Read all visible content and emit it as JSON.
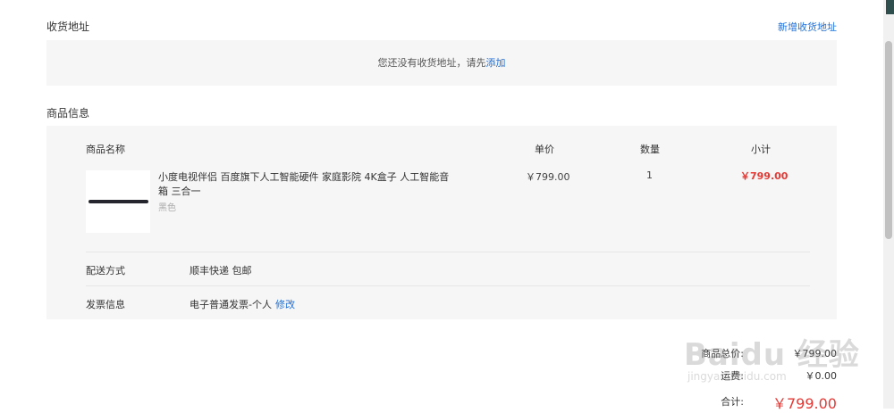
{
  "address": {
    "section_title": "收货地址",
    "add_new_label": "新增收货地址",
    "empty_prefix": "您还没有收货地址，请先",
    "empty_link": "添加"
  },
  "goods": {
    "section_title": "商品信息",
    "columns": {
      "name": "商品名称",
      "price": "单价",
      "quantity": "数量",
      "subtotal": "小计"
    },
    "item": {
      "title": "小度电视伴侣 百度旗下人工智能硬件 家庭影院 4K盒子 人工智能音箱 三合一",
      "variant": "黑色",
      "price": "￥799.00",
      "quantity": "1",
      "subtotal": "￥799.00"
    },
    "delivery": {
      "label": "配送方式",
      "value": "顺丰快递 包邮"
    },
    "invoice": {
      "label": "发票信息",
      "value": "电子普通发票-个人",
      "edit_label": "修改"
    }
  },
  "summary": {
    "goods_total_label": "商品总价:",
    "goods_total_value": "￥799.00",
    "shipping_label": "运费:",
    "shipping_value": "￥0.00",
    "total_label": "合计:",
    "total_value": "￥799.00"
  },
  "watermark": {
    "big": "Baidu 经验",
    "small": "jingyan.baidu.com"
  },
  "colors": {
    "accent_link": "#1e6fd9",
    "price_red": "#e53935",
    "panel_bg": "#f6f6f6"
  }
}
